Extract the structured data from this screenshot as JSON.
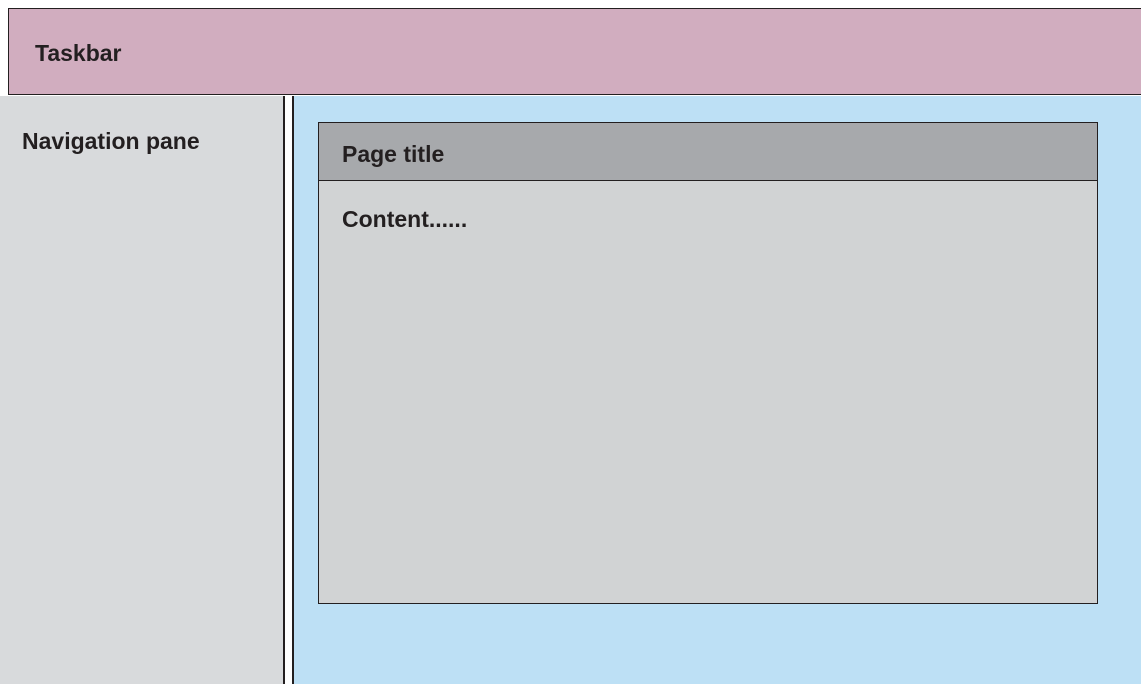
{
  "taskbar": {
    "label": "Taskbar"
  },
  "navigation": {
    "label": "Navigation pane"
  },
  "page": {
    "title": "Page title",
    "content": "Content......"
  },
  "colors": {
    "taskbar": "#d1adbf",
    "navigation": "#d8dadc",
    "main_area": "#bde0f5",
    "page_title_bar": "#a7a9ac",
    "page_body": "#d1d3d4",
    "outline": "#231f20",
    "text": "#231f20"
  }
}
